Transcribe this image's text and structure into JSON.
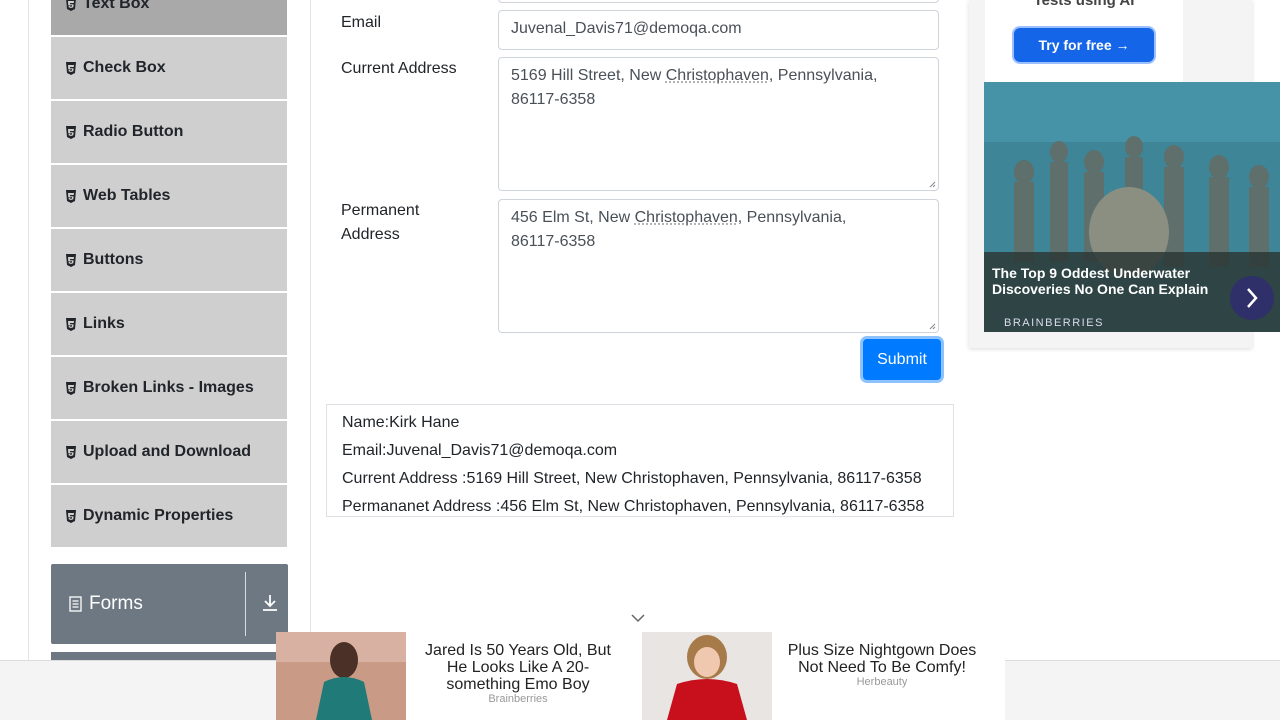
{
  "sidebar": {
    "items": [
      {
        "label": "Text Box",
        "active": true
      },
      {
        "label": "Check Box"
      },
      {
        "label": "Radio Button"
      },
      {
        "label": "Web Tables"
      },
      {
        "label": "Buttons"
      },
      {
        "label": "Links"
      },
      {
        "label": "Broken Links - Images"
      },
      {
        "label": "Upload and Download"
      },
      {
        "label": "Dynamic Properties"
      }
    ],
    "group": {
      "label": "Forms",
      "icon": "form-icon"
    }
  },
  "form": {
    "email_label": "Email",
    "email_value": "Juvenal_Davis71@demoqa.com",
    "current_label": "Current Address",
    "current_value": {
      "a": "5169 Hill Street, New ",
      "b": "Christophaven",
      "c": ", Pennsylvania,",
      "d": "86117-6358"
    },
    "permanent_label_1": "Permanent",
    "permanent_label_2": "Address",
    "permanent_value": {
      "a": "456 Elm St, New ",
      "b": "Christophaven",
      "c": ", Pennsylvania,",
      "d": "86117-6358"
    },
    "submit": "Submit"
  },
  "output": {
    "name": "Name:Kirk Hane",
    "email": "Email:Juvenal_Davis71@demoqa.com",
    "current": "Current Address :5169 Hill Street, New Christophaven, Pennsylvania, 86117-6358",
    "permanent": "Permananet Address :456 Elm St, New Christophaven, Pennsylvania, 86117-6358"
  },
  "ad_right": {
    "tagline": "Tests using AI",
    "button": "Try for free →",
    "caption": "The Top 9 Oddest Underwater Discoveries No One Can Explain",
    "brand": "BRAINBERRIES"
  },
  "ad_bottom": [
    {
      "title": "Jared Is 50 Years Old, But He Looks Like A 20-something Emo Boy",
      "source": "Brainberries"
    },
    {
      "title": "Plus Size Nightgown Does Not Need To Be Comfy!",
      "source": "Herbeauty"
    }
  ],
  "colors": {
    "primary": "#007bff",
    "sidebar_item": "#cfcfcf",
    "sidebar_active": "#a9a9a9",
    "group_header": "#6d7882"
  }
}
